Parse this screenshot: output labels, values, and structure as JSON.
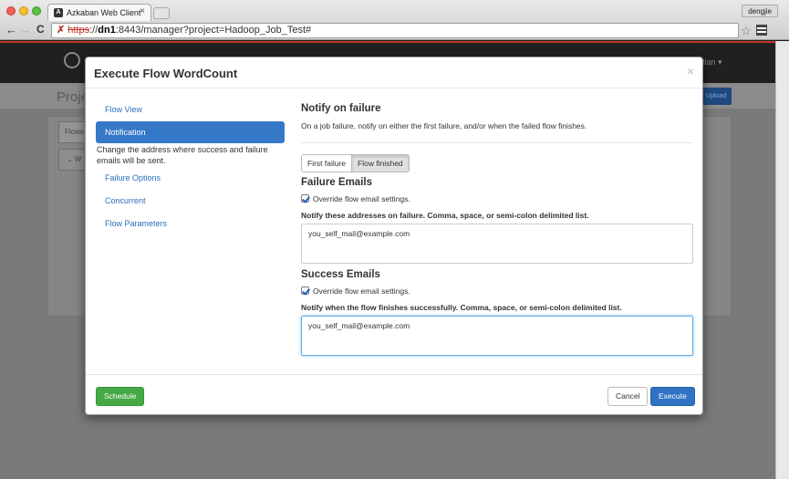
{
  "browser": {
    "tab_title": "Azkaban Web Client",
    "tab_close": "×",
    "tab_favicon": "A",
    "user": "dengjie",
    "url_lock": "✗",
    "url_scheme": "https",
    "url_sep": "://",
    "url_host": "dn1",
    "url_path": ":8443/manager?project=Hadoop_Job_Test#",
    "back": "←",
    "forward": "→",
    "reload": "C",
    "star": "☆",
    "icons": [
      "close-red",
      "minimize-yellow",
      "zoom-green",
      "back-arrow-icon",
      "forward-arrow-icon",
      "reload-icon",
      "star-icon",
      "menu-icon"
    ]
  },
  "background_page": {
    "title": "Proje",
    "user_menu": "tian ▾",
    "upload_label": "Upload",
    "flows_tab": "Flows",
    "row_label": "⌄ W"
  },
  "modal": {
    "title": "Execute Flow WordCount",
    "close": "×",
    "sidebar": {
      "items": [
        {
          "label": "Flow View",
          "active": false
        },
        {
          "label": "Notification",
          "active": true
        },
        {
          "label": "Failure Options",
          "active": false
        },
        {
          "label": "Concurrent",
          "active": false
        },
        {
          "label": "Flow Parameters",
          "active": false
        }
      ],
      "help_text": "Change the address where success and failure emails will be sent."
    },
    "notify": {
      "heading": "Notify on failure",
      "description": "On a job failure, notify on either the first failure, and/or when the failed flow finishes.",
      "options": [
        "First failure",
        "Flow finished"
      ],
      "selected": "Flow finished"
    },
    "failure_emails": {
      "heading": "Failure Emails",
      "override_label": "Override flow email settings.",
      "override_checked": true,
      "field_label": "Notify these addresses on failure. Comma, space, or semi-colon delimited list.",
      "value": "you_self_mail@example.com"
    },
    "success_emails": {
      "heading": "Success Emails",
      "override_label": "Override flow email settings.",
      "override_checked": true,
      "field_label": "Notify when the flow finishes successfully. Comma, space, or semi-colon delimited list.",
      "value": "you_self_mail@example.com"
    },
    "footer": {
      "schedule_label": "Schedule",
      "cancel_label": "Cancel",
      "execute_label": "Execute"
    }
  },
  "colors": {
    "primary": "#2f73c4",
    "success": "#44a845",
    "sidebar_active": "#3578c8",
    "link": "#2a6ebb"
  }
}
